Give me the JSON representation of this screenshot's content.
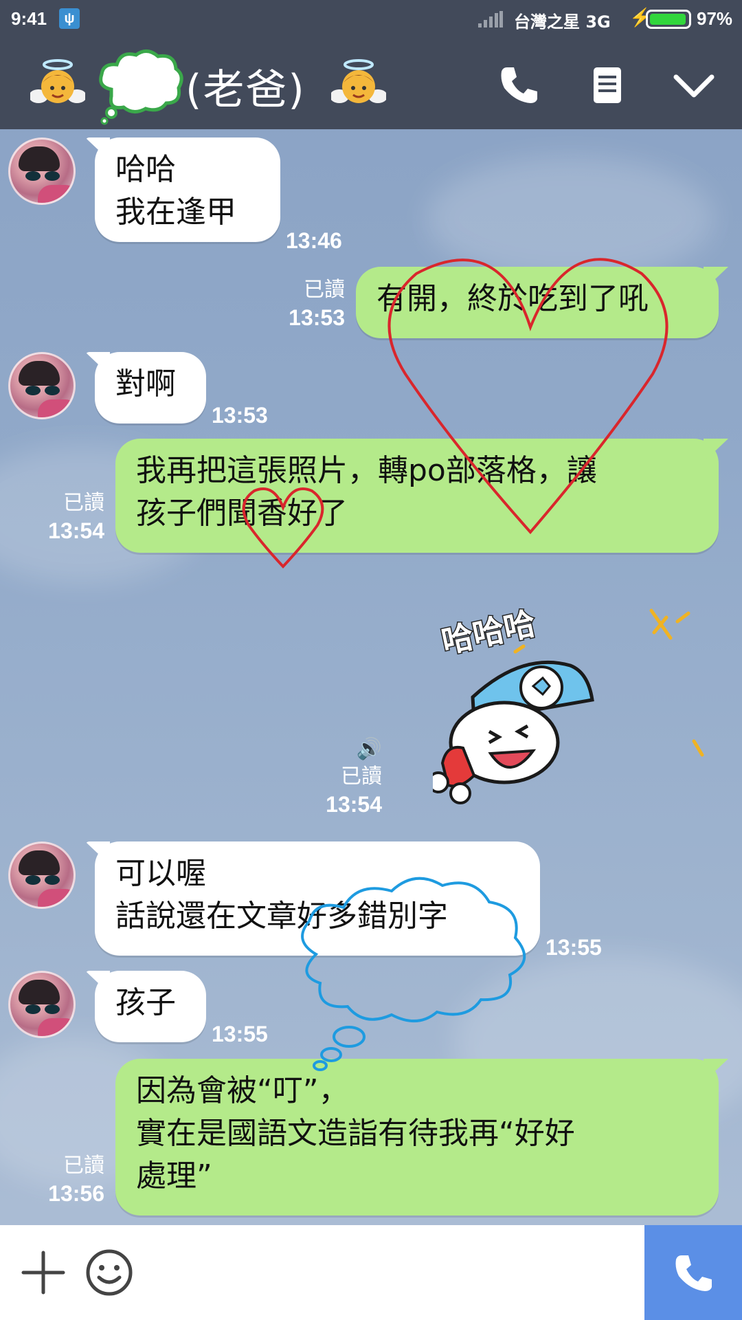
{
  "status_bar": {
    "time": "9:41",
    "carrier": "台灣之星 3G",
    "battery": "97%",
    "battery_level": 0.97,
    "usb_icon": "usb-icon",
    "colors": {
      "battery_fill": "#31d63c",
      "bar_bg": "#424a5a"
    }
  },
  "header": {
    "title": "(老爸)",
    "left_emoji": "angel-emoji-icon",
    "right_emoji": "angel-emoji-icon",
    "buttons": [
      "phone-icon",
      "notes-icon",
      "chevron-down-icon"
    ]
  },
  "messages": [
    {
      "id": "m1",
      "dir": "in",
      "text": "哈哈\n我在逢甲",
      "time": "13:46"
    },
    {
      "id": "m2",
      "dir": "out",
      "text": "有開，終於吃到了吼",
      "read": "已讀",
      "time": "13:53"
    },
    {
      "id": "m3",
      "dir": "in",
      "text": "對啊",
      "time": "13:53"
    },
    {
      "id": "m4",
      "dir": "out",
      "text": "我再把這張照片，轉po部落格，讓\n孩子們聞香好了",
      "read": "已讀",
      "time": "13:54"
    },
    {
      "id": "m5",
      "dir": "out",
      "type": "sticker",
      "sticker_text": "哈哈哈",
      "read": "已讀",
      "time": "13:54"
    },
    {
      "id": "m6",
      "dir": "in",
      "text": "可以喔\n話說還在文章好多錯別字",
      "time": "13:55"
    },
    {
      "id": "m7",
      "dir": "in",
      "text": "孩子",
      "time": "13:55"
    },
    {
      "id": "m8",
      "dir": "out",
      "text": "因為會被“叮”，\n實在是國語文造詣有待我再“好好\n處理”",
      "read": "已讀",
      "time": "13:56"
    }
  ],
  "input_bar": {
    "plus_icon": "plus-icon",
    "emoji_icon": "smiley-icon",
    "call_icon": "phone-icon",
    "colors": {
      "call_bg": "#5b8fe6"
    }
  },
  "colors": {
    "outgoing_bubble": "#b4ea8a",
    "incoming_bubble": "#ffffff",
    "annotation_red": "#d9262c",
    "annotation_blue": "#1e9be0",
    "annotation_green": "#3aa84a"
  }
}
